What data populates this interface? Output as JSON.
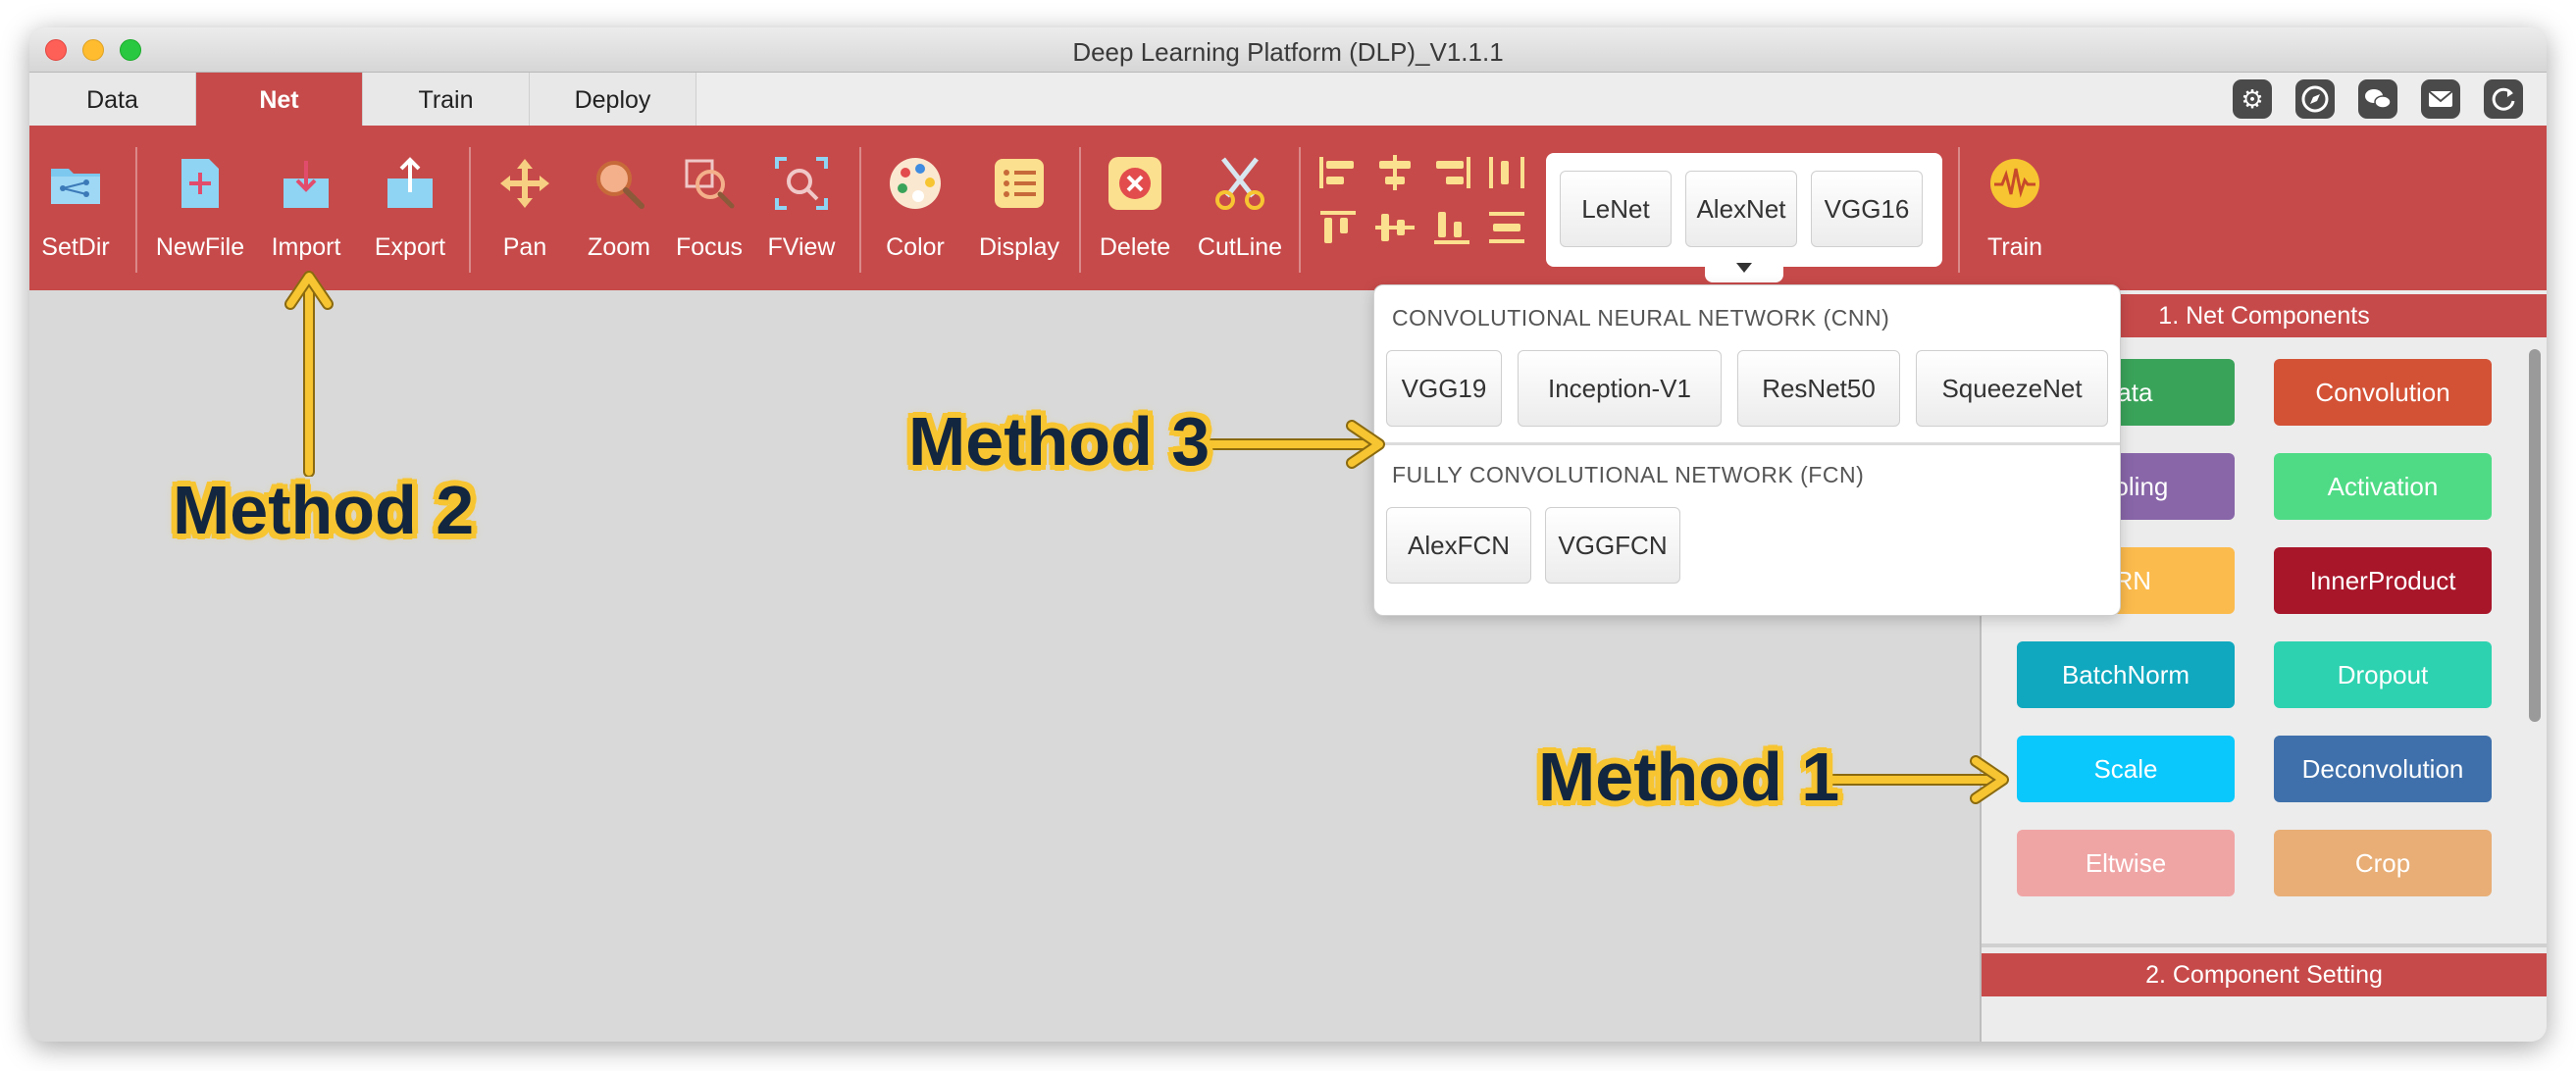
{
  "window": {
    "title": "Deep Learning Platform (DLP)_V1.1.1"
  },
  "tabs": [
    {
      "label": "Data"
    },
    {
      "label": "Net"
    },
    {
      "label": "Train"
    },
    {
      "label": "Deploy"
    }
  ],
  "top_icons": [
    "gear-icon",
    "compass-icon",
    "wechat-icon",
    "mail-icon",
    "refresh-icon"
  ],
  "toolbar": {
    "setdir": "SetDir",
    "newfile": "NewFile",
    "import": "Import",
    "export": "Export",
    "pan": "Pan",
    "zoom": "Zoom",
    "focus": "Focus",
    "fview": "FView",
    "color": "Color",
    "display": "Display",
    "delete": "Delete",
    "cutline": "CutLine",
    "train": "Train"
  },
  "presets": [
    "LeNet",
    "AlexNet",
    "VGG16"
  ],
  "dropdown": {
    "cnn_title": "CONVOLUTIONAL NEURAL NETWORK (CNN)",
    "cnn_models": [
      "VGG19",
      "Inception-V1",
      "ResNet50",
      "SqueezeNet"
    ],
    "fcn_title": "FULLY CONVOLUTIONAL NETWORK (FCN)",
    "fcn_models": [
      "AlexFCN",
      "VGGFCN"
    ]
  },
  "panel": {
    "net_components_title": "1. Net Components",
    "component_setting_title": "2. Component Setting",
    "components": [
      {
        "label": "Data",
        "color": "#3aa35a"
      },
      {
        "label": "Convolution",
        "color": "#d35236"
      },
      {
        "label": "Pooling",
        "color": "#8866a8"
      },
      {
        "label": "Activation",
        "color": "#4fdb86"
      },
      {
        "label": "LRN",
        "color": "#fbbb4d"
      },
      {
        "label": "InnerProduct",
        "color": "#a8162a"
      },
      {
        "label": "BatchNorm",
        "color": "#10a8bf"
      },
      {
        "label": "Dropout",
        "color": "#2dd2b0"
      },
      {
        "label": "Scale",
        "color": "#0ac8fb"
      },
      {
        "label": "Deconvolution",
        "color": "#3f70ab"
      },
      {
        "label": "Eltwise",
        "color": "#f0a5a5"
      },
      {
        "label": "Crop",
        "color": "#e8ae76"
      }
    ]
  },
  "annotations": {
    "method1": "Method 1",
    "method2": "Method 2",
    "method3": "Method 3",
    "highlight_color": "#f7c531"
  },
  "colors": {
    "accent": "#c74a4a"
  }
}
